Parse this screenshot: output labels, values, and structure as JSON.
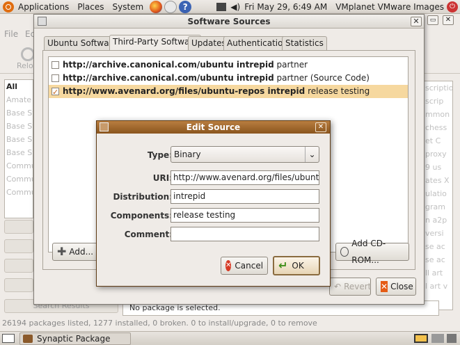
{
  "top_panel": {
    "menus": [
      "Applications",
      "Places",
      "System"
    ],
    "clock": "Fri May 29,  6:49 AM",
    "user": "VMplanet VMware Images"
  },
  "synaptic": {
    "menus": [
      "File",
      "Ec"
    ],
    "reload_label": "Reloa",
    "filter_items": [
      "All",
      "Amate",
      "Base Sy",
      "Base Sy",
      "Base Sy",
      "Base Sy",
      "Commu",
      "Commu",
      "Commu"
    ],
    "right_items": [
      "scriptio",
      "scrip",
      "mmon",
      "chess",
      "et C",
      "proxy",
      "9 us",
      "ates X",
      "ulatio",
      "gram",
      "n a2p",
      "versi",
      "se ac",
      "se ac",
      "ll art",
      "l art v"
    ],
    "search_results_label": "Search Results",
    "detail_text": "No package is selected.",
    "status_text": "26194 packages listed, 1277 installed, 0 broken. 0 to install/upgrade, 0 to remove"
  },
  "bottom_panel": {
    "task_label": "Synaptic Package Man..."
  },
  "software_sources": {
    "title": "Software Sources",
    "tabs": [
      "Ubuntu Software",
      "Third-Party Software",
      "Updates",
      "Authentication",
      "Statistics"
    ],
    "active_tab": "Third-Party Software",
    "sources": [
      {
        "checked": false,
        "url": "http://archive.canonical.com/ubuntu intrepid",
        "comp": "partner"
      },
      {
        "checked": false,
        "url": "http://archive.canonical.com/ubuntu intrepid",
        "comp": "partner (Source Code)"
      },
      {
        "checked": true,
        "url": "http://www.avenard.org/files/ubuntu-repos intrepid",
        "comp": "release testing"
      }
    ],
    "add_label": "Add...",
    "add_cdrom_label": "Add CD-ROM...",
    "revert_label": "Revert",
    "close_label": "Close"
  },
  "edit_source": {
    "title": "Edit Source",
    "type_label": "Type:",
    "type_value": "Binary",
    "uri_label": "URI:",
    "uri_value": "http://www.avenard.org/files/ubuntu-repo",
    "distribution_label": "Distribution:",
    "distribution_value": "intrepid",
    "components_label": "Components:",
    "components_value": "release testing",
    "comment_label": "Comment:",
    "comment_value": "",
    "cancel_label": "Cancel",
    "ok_label": "OK"
  }
}
